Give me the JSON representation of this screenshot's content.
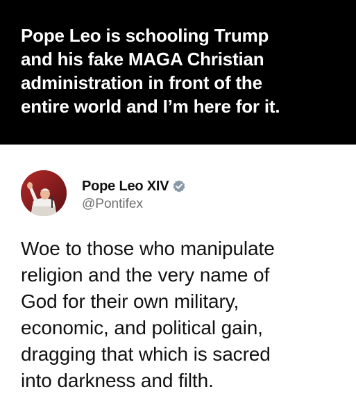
{
  "banner": {
    "headline": "Pope Leo is schooling Trump\nand his fake MAGA Christian\nadministration in front of the\nentire world and I’m here for it.",
    "background_color": "#000000",
    "text_color": "#ffffff"
  },
  "post": {
    "author": {
      "display_name": "Pope Leo XIV",
      "handle": "@Pontifex",
      "verified": true,
      "avatar_icon": "pope-avatar",
      "verified_icon": "verified-badge-icon",
      "verified_color": "#8a99a8"
    },
    "text": "Woe to those who manipulate\nreligion and the very name of\nGod for their own military,\neconomic, and political gain,\ndragging that which is sacred\ninto darkness and filth."
  }
}
